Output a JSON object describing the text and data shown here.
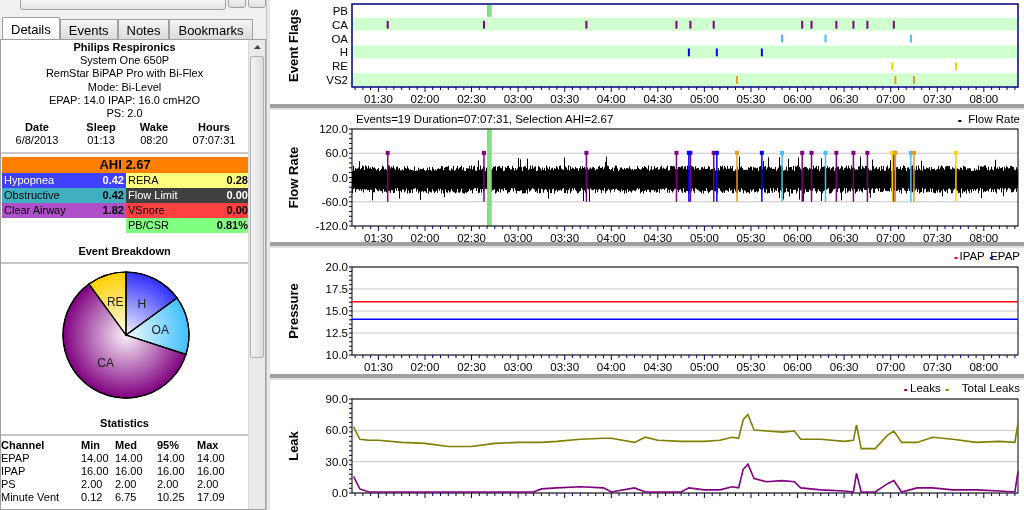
{
  "tabs": [
    {
      "label": "Details",
      "selected": true
    },
    {
      "label": "Events",
      "selected": false
    },
    {
      "label": "Notes",
      "selected": false
    },
    {
      "label": "Bookmarks",
      "selected": false
    }
  ],
  "device": {
    "manufacturer": "Philips Respironics",
    "lines": [
      "System One 650P",
      "RemStar BiPAP Pro with Bi-Flex",
      "Mode: Bi-Level",
      "EPAP: 14.0 IPAP: 16.0 cmH2O",
      "PS: 2.0"
    ]
  },
  "session": [
    {
      "heading": "Date",
      "value": "6/8/2013"
    },
    {
      "heading": "Sleep",
      "value": "01:13"
    },
    {
      "heading": "Wake",
      "value": "08:20"
    },
    {
      "heading": "Hours",
      "value": "07:07:31"
    }
  ],
  "ahi": {
    "label": "AHI 2.67",
    "left": [
      {
        "name": "Hypopnea",
        "value": "0.42",
        "color": "#4040ff"
      },
      {
        "name": "Obstructive",
        "value": "0.42",
        "color": "#40b0c0"
      },
      {
        "name": "Clear Airway",
        "value": "1.82",
        "color": "#b050c8"
      }
    ],
    "right": [
      {
        "name": "RERA",
        "value": "0.28",
        "color": "#ffff80"
      },
      {
        "name": "Flow Limit",
        "value": "0.00",
        "color": "#404040"
      },
      {
        "name": "VSnore",
        "value": "0.00",
        "color": "#ff4040"
      },
      {
        "name": "PB/CSR",
        "value": "0.81%",
        "color": "#80ff80"
      }
    ]
  },
  "event_breakdown": {
    "title": "Event Breakdown",
    "chart_data": {
      "type": "pie",
      "categories": [
        "H",
        "OA",
        "CA",
        "RE"
      ],
      "values": [
        15,
        15,
        60,
        10
      ],
      "colors": [
        "#3030ff",
        "#40c0ff",
        "#800080",
        "#ffd000"
      ]
    }
  },
  "statistics": {
    "title": "Statistics",
    "columns": [
      "Channel",
      "Min",
      "Med",
      "95%",
      "Max"
    ],
    "rows": [
      [
        "EPAP",
        "14.00",
        "14.00",
        "14.00",
        "14.00"
      ],
      [
        "IPAP",
        "16.00",
        "16.00",
        "16.00",
        "16.00"
      ],
      [
        "PS",
        "2.00",
        "2.00",
        "2.00",
        "2.00"
      ],
      [
        "Minute Vent",
        "0.12",
        "6.75",
        "10.25",
        "17.09"
      ]
    ]
  },
  "graphs": [
    {
      "kind": "flags",
      "ylabel": "Event Flags",
      "xticks": [
        "01:30",
        "02:00",
        "02:30",
        "03:00",
        "03:30",
        "04:00",
        "04:30",
        "05:00",
        "05:30",
        "06:00",
        "06:30",
        "07:00",
        "07:30",
        "08:00"
      ],
      "rows": [
        {
          "label": "PB",
          "color": "#80e080",
          "kind": "span"
        },
        {
          "label": "CA",
          "color": "#800080",
          "kind": "mark"
        },
        {
          "label": "OA",
          "color": "#40c0ff",
          "kind": "mark"
        },
        {
          "label": "H",
          "color": "#0000ff",
          "kind": "mark"
        },
        {
          "label": "RE",
          "color": "#ffd000",
          "kind": "mark"
        },
        {
          "label": "VS2",
          "color": "#e0a020",
          "kind": "mark"
        }
      ]
    },
    {
      "kind": "waveform",
      "header": "Events=19 Duration=07:07:31, Selection AHI=2.67",
      "legend": [
        {
          "name": "Flow Rate",
          "color": "#000000"
        }
      ],
      "ylabel": "Flow Rate",
      "yticks": [
        "120.0",
        "60.0",
        "0.0",
        "-60.0",
        "-120.0"
      ],
      "xticks": [
        "01:30",
        "02:00",
        "02:30",
        "03:00",
        "03:30",
        "04:00",
        "04:30",
        "05:00",
        "05:30",
        "06:00",
        "06:30",
        "07:00",
        "07:30",
        "08:00"
      ]
    },
    {
      "kind": "line",
      "chart_data": {
        "type": "line",
        "ylabel": "Pressure",
        "grid": true,
        "legend": "upper right",
        "xlim": [
          73,
          502
        ],
        "ylim": [
          10,
          20
        ],
        "yticks": [
          {
            "value": 20,
            "label": "20.0"
          },
          {
            "value": 17.5,
            "label": "17.5"
          },
          {
            "value": 15,
            "label": "15.0"
          },
          {
            "value": 12.5,
            "label": "12.5"
          },
          {
            "value": 10,
            "label": "10.0"
          }
        ],
        "xticks": [
          {
            "value": 90,
            "label": "01:30"
          },
          {
            "value": 120,
            "label": "02:00"
          },
          {
            "value": 150,
            "label": "02:30"
          },
          {
            "value": 180,
            "label": "03:00"
          },
          {
            "value": 210,
            "label": "03:30"
          },
          {
            "value": 240,
            "label": "04:00"
          },
          {
            "value": 270,
            "label": "04:30"
          },
          {
            "value": 300,
            "label": "05:00"
          },
          {
            "value": 330,
            "label": "05:30"
          },
          {
            "value": 360,
            "label": "06:00"
          },
          {
            "value": 390,
            "label": "06:30"
          },
          {
            "value": 420,
            "label": "07:00"
          },
          {
            "value": 450,
            "label": "07:30"
          },
          {
            "value": 480,
            "label": "08:00"
          }
        ],
        "x": [
          73,
          502
        ],
        "series": [
          {
            "name": "IPAP",
            "color": "#ff0000",
            "values": [
              16,
              16
            ]
          },
          {
            "name": "EPAP",
            "color": "#0000ff",
            "values": [
              14,
              14
            ]
          }
        ]
      }
    },
    {
      "kind": "line",
      "chart_data": {
        "type": "line",
        "ylabel": "Leak",
        "grid": true,
        "legend": "upper right",
        "xlim": [
          73,
          502
        ],
        "ylim": [
          0,
          90
        ],
        "yticks": [
          {
            "value": 90,
            "label": "90.0"
          },
          {
            "value": 60,
            "label": "60.0"
          },
          {
            "value": 30,
            "label": "30.0"
          },
          {
            "value": 0,
            "label": "0.0"
          }
        ],
        "x": [
          74,
          78,
          84,
          90,
          105,
          120,
          135,
          150,
          165,
          180,
          190,
          195,
          205,
          220,
          235,
          240,
          255,
          262,
          270,
          285,
          290,
          300,
          310,
          318,
          322,
          325,
          328,
          332,
          340,
          350,
          358,
          362,
          375,
          390,
          396,
          398,
          401,
          410,
          418,
          422,
          427,
          437,
          447,
          460,
          475,
          490,
          500,
          502
        ],
        "series": [
          {
            "name": "Leaks",
            "color": "#800080",
            "values": [
              15,
              3,
              0,
              0,
              0,
              0,
              0,
              0,
              0,
              0,
              0,
              3,
              4,
              5,
              4,
              0,
              4,
              0,
              0,
              0,
              4,
              2,
              2,
              5,
              4,
              22,
              27,
              13,
              10,
              11,
              10,
              4,
              2,
              1,
              0,
              18,
              0,
              0,
              8,
              11,
              0,
              4,
              4,
              2,
              2,
              1,
              0,
              20
            ]
          },
          {
            "name": "Total Leaks",
            "color": "#808000",
            "values": [
              63,
              51,
              50,
              50,
              48,
              47,
              44,
              44,
              47,
              48,
              48,
              48,
              49,
              51,
              52,
              52,
              48,
              53,
              50,
              49,
              49,
              49,
              50,
              53,
              52,
              70,
              75,
              60,
              59,
              58,
              59,
              51,
              51,
              49,
              50,
              65,
              42,
              42,
              55,
              59,
              48,
              48,
              53,
              51,
              48,
              49,
              48,
              67
            ]
          }
        ]
      }
    }
  ]
}
